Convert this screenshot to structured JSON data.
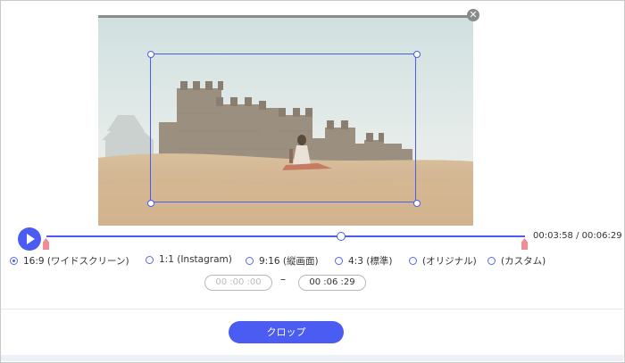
{
  "dialog": {
    "close_glyph": "✕"
  },
  "player": {
    "position": "00:03:58",
    "duration": "00:06:29",
    "progress_fraction": 0.615
  },
  "aspect_ratios": [
    {
      "label": "16:9 (ワイドスクリーン)",
      "selected": true
    },
    {
      "label": "1:1 (Instagram)",
      "selected": false
    },
    {
      "label": "9:16 (縦画面)",
      "selected": false
    },
    {
      "label": "4:3 (標準)",
      "selected": false
    },
    {
      "label": "(オリジナル)",
      "selected": false
    },
    {
      "label": "(カスタム)",
      "selected": false
    }
  ],
  "time_range": {
    "start": "00 :00 :00",
    "separator": "–",
    "end": "00 :06 :29"
  },
  "actions": {
    "crop_label": "クロップ"
  },
  "colors": {
    "accent": "#4b5cf2",
    "marker": "#f28b95"
  }
}
